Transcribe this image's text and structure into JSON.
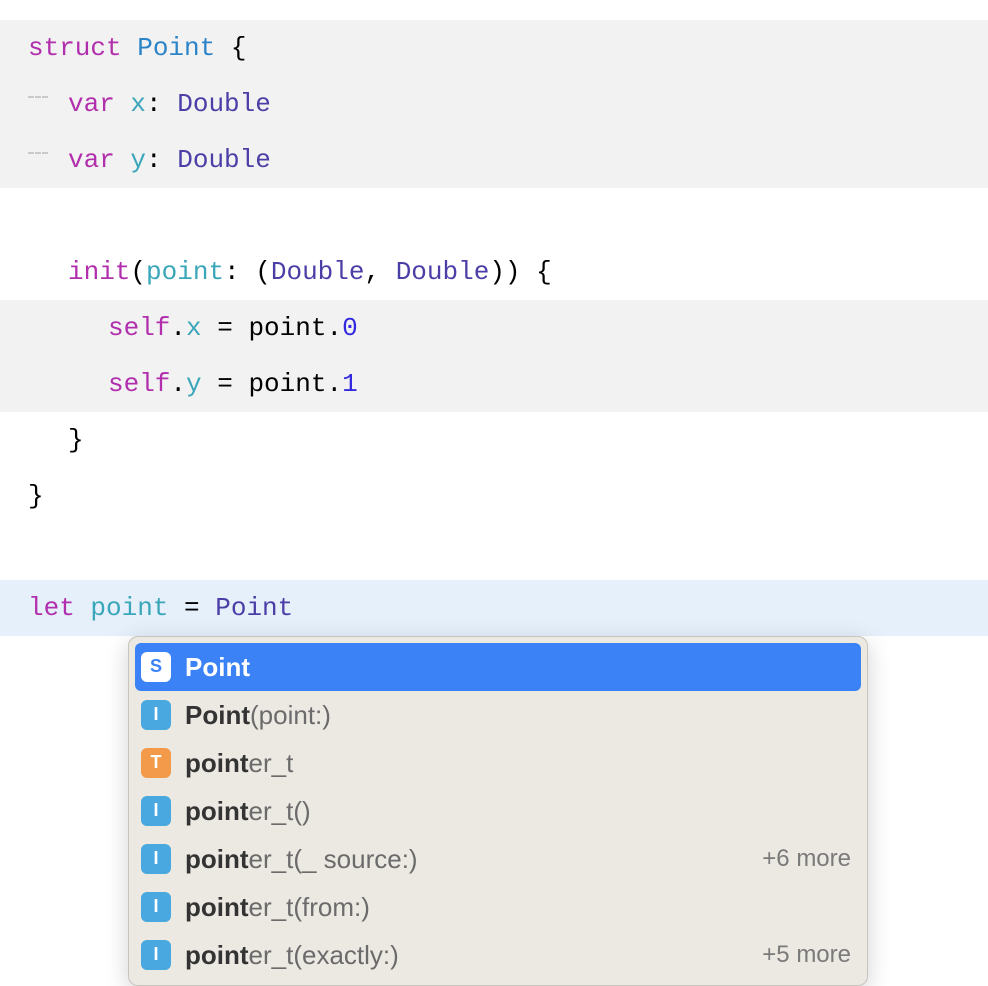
{
  "code": {
    "line1": {
      "kw": "struct",
      "name": " Point",
      "brace": " {"
    },
    "line2": {
      "kw": "var",
      "prop": " x",
      "colon": ": ",
      "type": "Double"
    },
    "line3": {
      "kw": "var",
      "prop": " y",
      "colon": ": ",
      "type": "Double"
    },
    "line4": "",
    "line5": {
      "kw": "init",
      "lp": "(",
      "param": "point",
      "colon": ": (",
      "t1": "Double",
      "comma": ", ",
      "t2": "Double",
      "rp": "))",
      "brace": " {"
    },
    "line6": {
      "self": "self",
      "dot": ".",
      "prop": "x",
      "eq": " = ",
      "rhs": "point",
      "dot2": ".",
      "num": "0"
    },
    "line7": {
      "self": "self",
      "dot": ".",
      "prop": "y",
      "eq": " = ",
      "rhs": "point",
      "dot2": ".",
      "num": "1"
    },
    "line8": {
      "brace": "}"
    },
    "line9": {
      "brace": "}"
    },
    "line10": "",
    "line11": {
      "kw": "let",
      "name": " point",
      "eq": " = ",
      "type": "Point"
    }
  },
  "completion": {
    "items": {
      "0": {
        "badge_letter": "S",
        "bold": "Point",
        "rest": ""
      },
      "1": {
        "badge_letter": "I",
        "bold": "Point",
        "rest": "(point:)"
      },
      "2": {
        "badge_letter": "T",
        "bold": "point",
        "rest": "er_t"
      },
      "3": {
        "badge_letter": "I",
        "bold": "point",
        "rest": "er_t()"
      },
      "4": {
        "badge_letter": "I",
        "bold": "point",
        "rest": "er_t(_ source:)",
        "more": "+6 more"
      },
      "5": {
        "badge_letter": "I",
        "bold": "point",
        "rest": "er_t(from:)"
      },
      "6": {
        "badge_letter": "I",
        "bold": "point",
        "rest": "er_t(exactly:)",
        "more": "+5 more"
      }
    }
  }
}
